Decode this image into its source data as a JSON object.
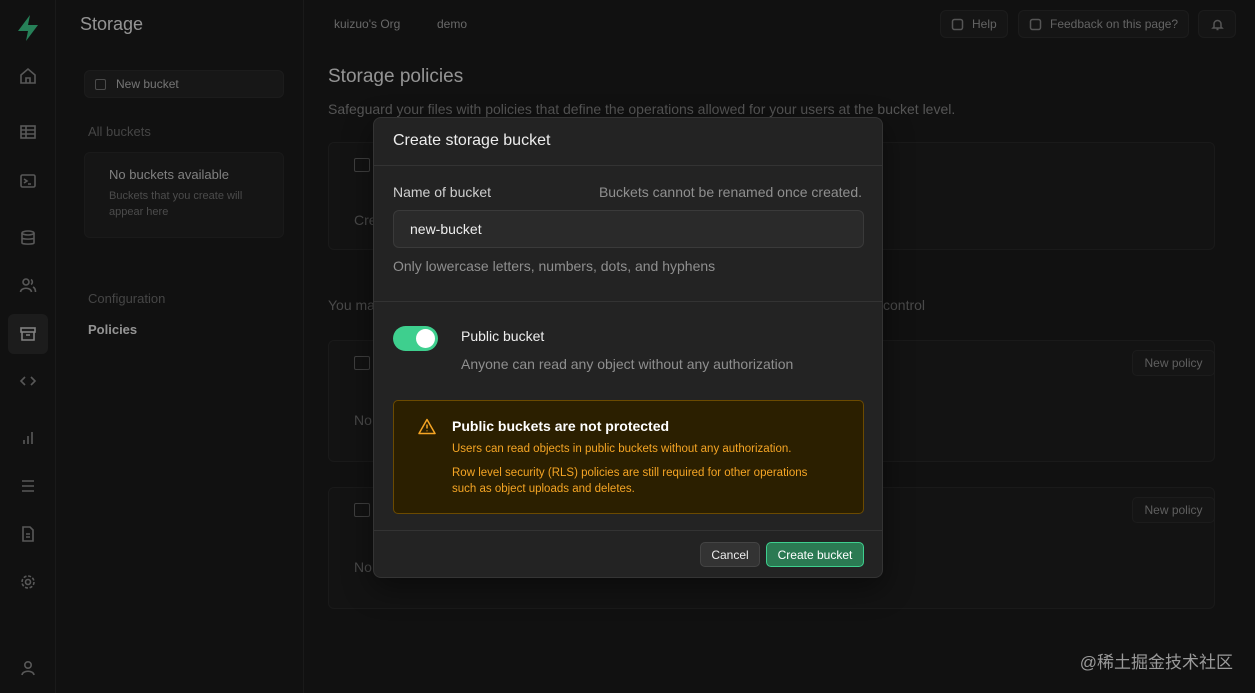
{
  "app": {
    "section_title": "Storage",
    "org": "kuizuo's Org",
    "project": "demo"
  },
  "topbar": {
    "help_label": "Help",
    "feedback_label": "Feedback on this page?"
  },
  "sidebar": {
    "new_bucket_label": "New bucket",
    "all_buckets_label": "All buckets",
    "empty_title": "No buckets available",
    "empty_desc": "Buckets that you create will appear here",
    "configuration_label": "Configuration",
    "policies_label": "Policies"
  },
  "rail": {
    "icons": [
      "home-icon",
      "table-icon",
      "terminal-icon",
      "database-icon",
      "users-icon",
      "storage-icon",
      "code-icon",
      "reports-icon",
      "logs-icon",
      "docs-icon",
      "settings-icon",
      "profile-icon"
    ],
    "active": "storage-icon"
  },
  "main": {
    "title": "Storage policies",
    "subtitle": "Safeguard your files with policies that define the operations allowed for your users at the bucket level.",
    "card1_text": "Cre",
    "partial_left": "You ma",
    "partial_right": "control",
    "new_policy_label": "New policy",
    "no_text": "No"
  },
  "modal": {
    "title": "Create storage bucket",
    "name_label": "Name of bucket",
    "name_hint": "Buckets cannot be renamed once created.",
    "name_value": "new-bucket",
    "name_help": "Only lowercase letters, numbers, dots, and hyphens",
    "public_label": "Public bucket",
    "public_desc": "Anyone can read any object without any authorization",
    "public_enabled": true,
    "warning_title": "Public buckets are not protected",
    "warning_line1": "Users can read objects in public buckets without any authorization.",
    "warning_line2": "Row level security (RLS) policies are still required for other operations",
    "warning_line3": "such as object uploads and deletes.",
    "cancel_label": "Cancel",
    "create_label": "Create bucket"
  },
  "colors": {
    "brand": "#3ecf8e",
    "warning": "#f5a524"
  },
  "watermark": "@稀土掘金技术社区"
}
